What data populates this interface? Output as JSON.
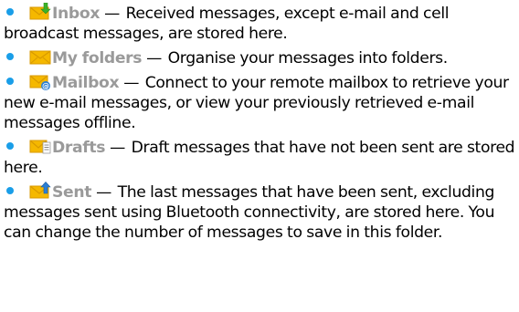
{
  "items": [
    {
      "icon": "inbox-envelope-icon",
      "label": "Inbox",
      "dash": "—",
      "description": "Received messages, except e-mail and cell broadcast messages, are stored here."
    },
    {
      "icon": "folders-envelope-icon",
      "label": "My folders",
      "dash": "—",
      "description": "Organise your messages into folders."
    },
    {
      "icon": "mailbox-envelope-icon",
      "label": "Mailbox",
      "dash": "—",
      "description": "Connect to your remote mailbox to retrieve your new e-mail messages, or view your previously retrieved e-mail messages offline."
    },
    {
      "icon": "drafts-envelope-icon",
      "label": "Drafts",
      "dash": "—",
      "description": "Draft messages that have not been sent are stored here."
    },
    {
      "icon": "sent-envelope-icon",
      "label": "Sent",
      "dash": "—",
      "description": "The last messages that have been sent, excluding messages sent using Bluetooth connectivity, are stored here. You can change the number of messages to save in this folder."
    }
  ],
  "colors": {
    "bullet": "#1a9ee8",
    "label": "#9a9a9a",
    "envelope": "#f5b800",
    "accent_green": "#3cb22a",
    "accent_blue": "#2b7fd4"
  }
}
